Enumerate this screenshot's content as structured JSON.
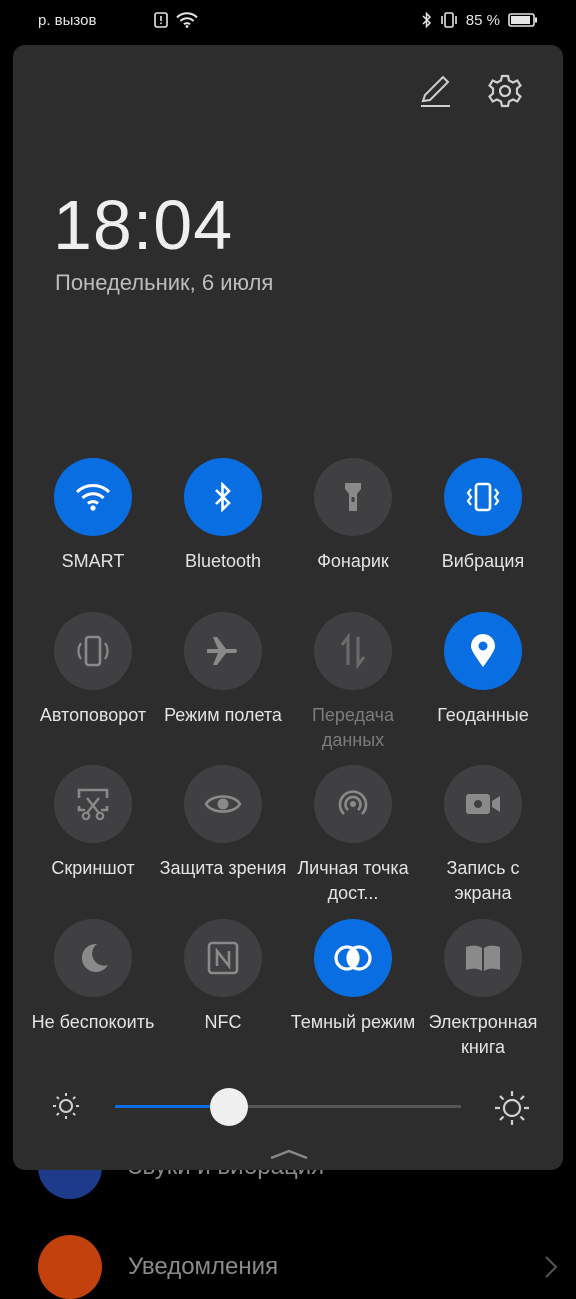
{
  "status": {
    "carrier": "р. вызов",
    "battery": "85 %"
  },
  "background": {
    "items": [
      {
        "label": "Звуки и вибрация",
        "color": "#1e3a8a"
      },
      {
        "label": "Уведомления",
        "color": "#c2410c"
      }
    ]
  },
  "panel": {
    "time": "18:04",
    "date": "Понедельник, 6 июля",
    "tiles": [
      {
        "label": "SMART",
        "icon": "wifi-icon",
        "on": true
      },
      {
        "label": "Bluetooth",
        "icon": "bluetooth-icon",
        "on": true
      },
      {
        "label": "Фонарик",
        "icon": "flashlight-icon",
        "on": false
      },
      {
        "label": "Вибрация",
        "icon": "vibration-icon",
        "on": true
      },
      {
        "label": "Автоповорот",
        "icon": "autorotate-icon",
        "on": false
      },
      {
        "label": "Режим полета",
        "icon": "airplane-icon",
        "on": false
      },
      {
        "label": "Передача данных",
        "icon": "mobile-data-icon",
        "on": false,
        "dim": true
      },
      {
        "label": "Геоданные",
        "icon": "location-icon",
        "on": true
      },
      {
        "label": "Скриншот",
        "icon": "screenshot-icon",
        "on": false
      },
      {
        "label": "Защита зрения",
        "icon": "eye-icon",
        "on": false
      },
      {
        "label": "Личная точка дост...",
        "icon": "hotspot-icon",
        "on": false
      },
      {
        "label": "Запись с экрана",
        "icon": "screen-record-icon",
        "on": false
      },
      {
        "label": "Не беспокоить",
        "icon": "moon-icon",
        "on": false
      },
      {
        "label": "NFC",
        "icon": "nfc-icon",
        "on": false
      },
      {
        "label": "Темный режим",
        "icon": "dark-mode-icon",
        "on": true
      },
      {
        "label": "Электронная книга",
        "icon": "book-icon",
        "on": false
      }
    ],
    "brightness": 0.33
  },
  "colors": {
    "accent": "#0a6ee3",
    "panel": "#2d2d2e",
    "tile_off": "#404042"
  }
}
